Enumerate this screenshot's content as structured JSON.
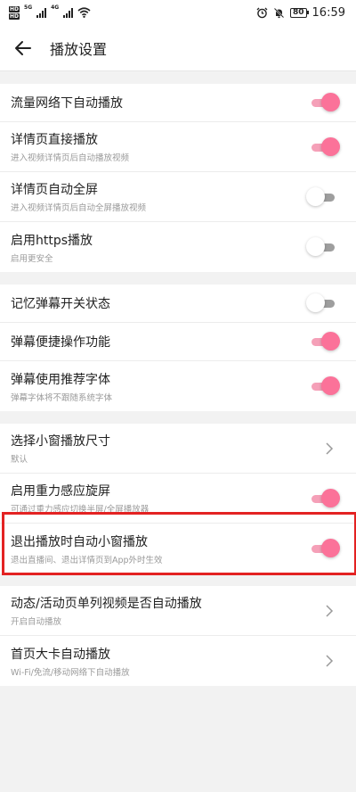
{
  "status_bar": {
    "hd1": "HD",
    "hd2": "HD",
    "net1": "5G",
    "net2": "4G",
    "battery": "80",
    "time": "16:59"
  },
  "header": {
    "title": "播放设置"
  },
  "sections": [
    [
      {
        "title": "流量网络下自动播放",
        "sub": "",
        "control": "toggle",
        "on": true
      },
      {
        "title": "详情页直接播放",
        "sub": "进入视频详情页后自动播放视频",
        "control": "toggle",
        "on": true
      },
      {
        "title": "详情页自动全屏",
        "sub": "进入视频详情页后自动全屏播放视频",
        "control": "toggle",
        "on": false
      },
      {
        "title": "启用https播放",
        "sub": "启用更安全",
        "control": "toggle",
        "on": false
      }
    ],
    [
      {
        "title": "记忆弹幕开关状态",
        "sub": "",
        "control": "toggle",
        "on": false
      },
      {
        "title": "弹幕便捷操作功能",
        "sub": "",
        "control": "toggle",
        "on": true
      },
      {
        "title": "弹幕使用推荐字体",
        "sub": "弹幕字体将不跟随系统字体",
        "control": "toggle",
        "on": true
      }
    ],
    [
      {
        "title": "选择小窗播放尺寸",
        "sub": "默认",
        "control": "arrow"
      },
      {
        "title": "启用重力感应旋屏",
        "sub": "可通过重力感应切换半屏/全屏播放器",
        "control": "toggle",
        "on": true
      },
      {
        "title": "退出播放时自动小窗播放",
        "sub": "退出直播间、退出详情页到App外时生效",
        "control": "toggle",
        "on": true
      }
    ],
    [
      {
        "title": "动态/活动页单列视频是否自动播放",
        "sub": "开启自动播放",
        "control": "arrow"
      },
      {
        "title": "首页大卡自动播放",
        "sub": "Wi-Fi/免流/移动网络下自动播放",
        "control": "arrow"
      }
    ]
  ],
  "colors": {
    "accent": "#fb7299",
    "accent_track": "#f5a0b8",
    "highlight_border": "#e32222",
    "background": "#f2f2f2"
  }
}
